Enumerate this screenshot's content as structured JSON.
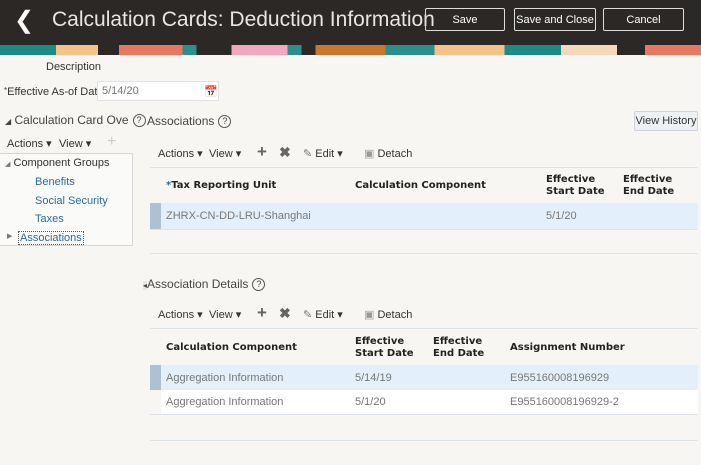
{
  "header": {
    "title": "Calculation Cards: Deduction Information",
    "save": "Save",
    "save_close": "Save and Close",
    "cancel": "Cancel"
  },
  "form": {
    "description_label": "Description",
    "effective_label": "Effective As-of Date",
    "effective_value": "5/14/20"
  },
  "left": {
    "title": "Calculation Card Ove",
    "actions": "Actions",
    "view": "View",
    "tree": [
      "Component Groups",
      "Benefits",
      "Social Security",
      "Taxes",
      "Associations"
    ]
  },
  "associations": {
    "title": "Associations",
    "view_history": "View History",
    "toolbar": {
      "actions": "Actions",
      "view": "View",
      "edit": "Edit",
      "detach": "Detach"
    },
    "columns": [
      "Tax Reporting Unit",
      "Calculation Component",
      "Effective Start Date",
      "Effective End Date"
    ],
    "rows": [
      [
        "ZHRX-CN-DD-LRU-Shanghai",
        "",
        "5/1/20",
        ""
      ]
    ]
  },
  "details": {
    "title": "Association Details",
    "toolbar": {
      "actions": "Actions",
      "view": "View",
      "edit": "Edit",
      "detach": "Detach"
    },
    "columns": [
      "Calculation Component",
      "Effective Start Date",
      "Effective End Date",
      "Assignment Number"
    ],
    "rows": [
      [
        "Aggregation Information",
        "5/14/19",
        "",
        "E955160008196929"
      ],
      [
        "Aggregation Information",
        "5/1/20",
        "",
        "E955160008196929-2"
      ]
    ]
  }
}
